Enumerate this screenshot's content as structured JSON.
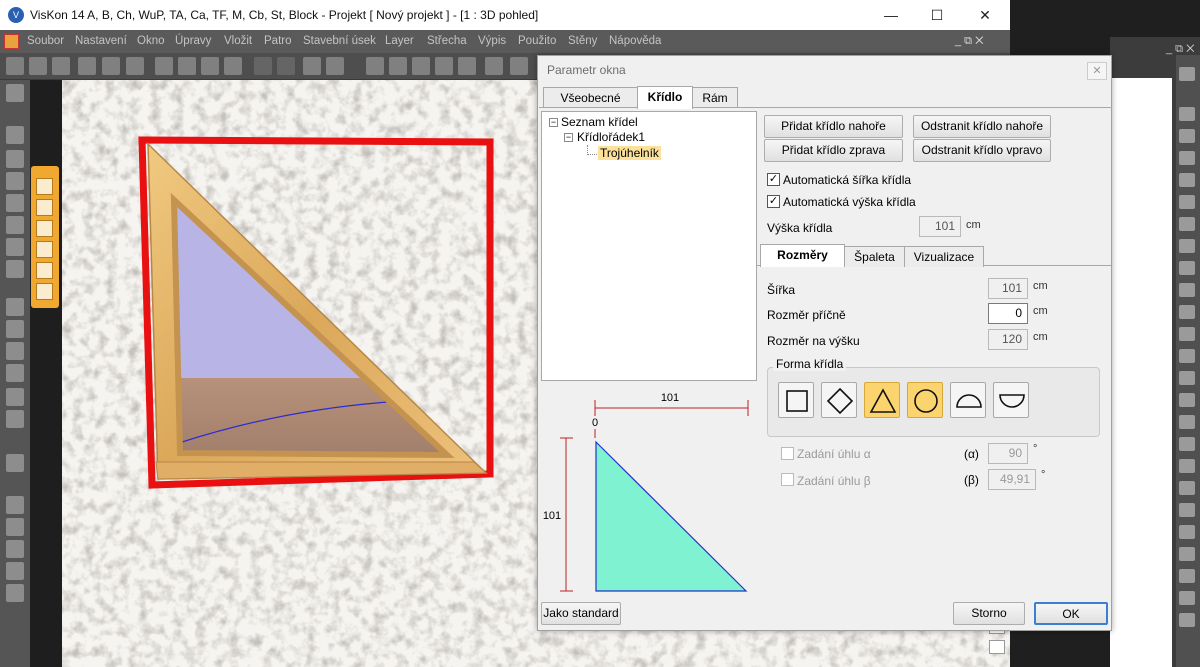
{
  "window": {
    "title": "VisKon 14 A, B, Ch, WuP, TA, Ca, TF, M, Cb, St, Block - Projekt [ Nový projekt ]  - [1 : 3D pohled]",
    "minimize": "—",
    "maximize": "☐",
    "close": "✕"
  },
  "menu": {
    "items": [
      "Soubor",
      "Nastavení",
      "Okno",
      "Úpravy",
      "Vložit",
      "Patro",
      "Stavební úsek",
      "Layer",
      "Střecha",
      "Výpis",
      "Použito",
      "Stěny",
      "Nápověda"
    ],
    "mdi_controls": "_ ⧉ ✕"
  },
  "dialog": {
    "title": "Parametr okna",
    "close": "✕",
    "tabs": [
      "Všeobecné",
      "Křídlo",
      "Rám"
    ],
    "active_tab": "Křídlo",
    "tree": {
      "root": "Seznam křídel",
      "child": "Křídlořádek1",
      "leaf": "Trojúhelník"
    },
    "buttons": {
      "add_top": "Přidat křídlo nahoře",
      "remove_top": "Odstranit křídlo nahoře",
      "add_right": "Přidat křídlo zprava",
      "remove_right": "Odstranit křídlo vpravo"
    },
    "auto_width": {
      "label": "Automatická šířka křídla",
      "checked": "✓"
    },
    "auto_height": {
      "label": "Automatická výška křídla",
      "checked": "✓"
    },
    "height": {
      "label": "Výška křídla",
      "value": "101",
      "unit": "cm"
    },
    "subtabs": [
      "Rozměry",
      "Špaleta",
      "Vizualizace"
    ],
    "active_subtab": "Rozměry",
    "width": {
      "label": "Šířka",
      "value": "101",
      "unit": "cm"
    },
    "cross": {
      "label": "Rozměr příčně",
      "value": "0",
      "unit": "cm"
    },
    "vertical": {
      "label": "Rozměr na výšku",
      "value": "120",
      "unit": "cm"
    },
    "forma": {
      "label": "Forma křídla",
      "shapes": [
        "square-icon",
        "diamond-icon",
        "triangle-icon",
        "circle-icon",
        "half-circle-up-icon",
        "half-circle-down-icon"
      ],
      "selected": [
        "triangle-icon",
        "circle-icon"
      ]
    },
    "alpha": {
      "label": "Zadání úhlu α",
      "symbol": "(α)",
      "value": "90",
      "unit": "°"
    },
    "beta": {
      "label": "Zadání úhlu β",
      "symbol": "(β)",
      "value": "49,91",
      "unit": "°"
    },
    "preview": {
      "top_dim": "101",
      "side_dim": "101",
      "zero": "0",
      "fill": "#7ff2d2",
      "stroke": "#2233cc"
    },
    "footer": {
      "standard": "Jako standard",
      "cancel": "Storno",
      "ok": "OK"
    }
  },
  "scene": {
    "frame_color": "#e81010",
    "wood_color": "#e6b86a",
    "glass_color": "#b8b4e6"
  }
}
